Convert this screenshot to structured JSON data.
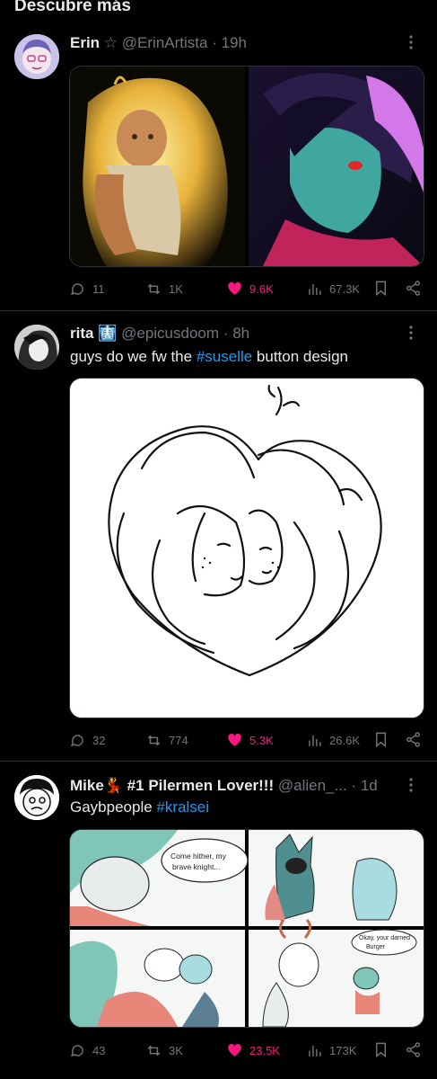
{
  "section_title": "Descubre más",
  "tweets": [
    {
      "name": "Erin",
      "badge": "☆",
      "handle": "@ErinArtista",
      "dot": "·",
      "time": "19h",
      "text": "",
      "replies": "11",
      "reposts": "1K",
      "likes": "9.6K",
      "views": "67.3K"
    },
    {
      "name": "rita",
      "badge": "🩻",
      "handle": "@epicusdoom",
      "dot": "·",
      "time": "8h",
      "text_plain": "guys do we fw the ",
      "hashtag": "#suselle",
      "text_after": " button design",
      "replies": "32",
      "reposts": "774",
      "likes": "5.3K",
      "views": "26.6K"
    },
    {
      "name": "Mike💃 #1 Pilermen Lover!!!",
      "handle": "@alien_...",
      "dot": "·",
      "time": "1d",
      "text_plain": "Gaybpeople ",
      "hashtag": "#kralsei",
      "replies": "43",
      "reposts": "3K",
      "likes": "23.5K",
      "views": "173K",
      "comic_bubble_1": "Come hither, my brave knight...",
      "comic_bubble_2": "Okay, your darned Burger"
    }
  ],
  "colors": {
    "background": "#000000",
    "text": "#e7e9ea",
    "muted": "#71767b",
    "link": "#1d9bf0",
    "like": "#f91880",
    "divider": "#2f3336"
  },
  "icons": [
    "reply-icon",
    "repost-icon",
    "heart-icon",
    "views-icon",
    "bookmark-icon",
    "share-icon",
    "more-icon"
  ]
}
